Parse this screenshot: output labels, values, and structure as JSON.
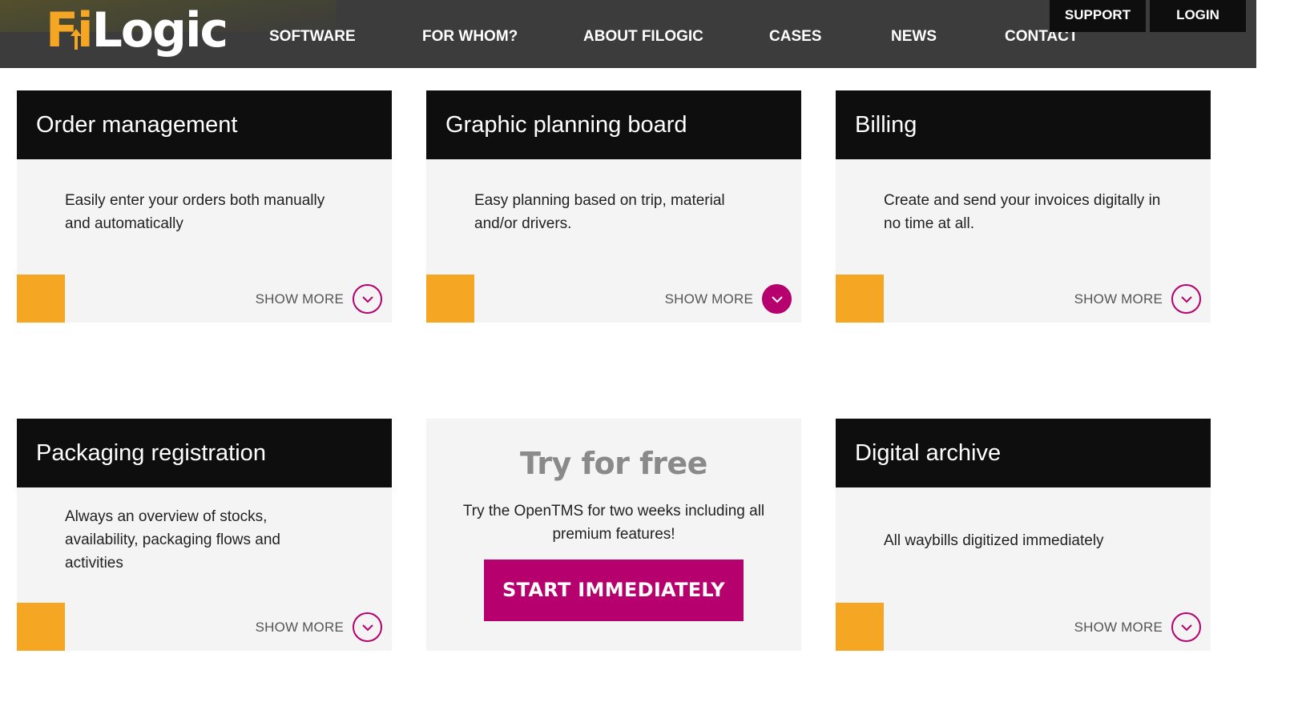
{
  "brand": {
    "logo_fi": "Fi",
    "logo_rest": "Logic",
    "accent": "#f5a623",
    "magenta": "#b5006e"
  },
  "nav": [
    "SOFTWARE",
    "FOR WHOM?",
    "ABOUT FILOGIC",
    "CASES",
    "NEWS",
    "CONTACT"
  ],
  "top_buttons": {
    "support": "SUPPORT",
    "login": "LOGIN"
  },
  "cards": [
    {
      "title": "Order management",
      "desc": "Easily enter your orders both manually and automatically",
      "show_more": "SHOW MORE",
      "icon": "chevron-down-icon",
      "active": false
    },
    {
      "title": "Graphic planning board",
      "desc": "Easy planning based on trip, material and/or drivers.",
      "show_more": "SHOW MORE",
      "icon": "chevron-down-icon",
      "active": true
    },
    {
      "title": "Billing",
      "desc": "Create and send your invoices digitally in no time at all.",
      "show_more": "SHOW MORE",
      "icon": "chevron-down-icon",
      "active": false
    },
    {
      "title": "Packaging registration",
      "desc": "Always an overview of stocks, availability, packaging flows and activities",
      "show_more": "SHOW MORE",
      "icon": "chevron-down-icon",
      "active": false
    },
    {
      "title": "Digital archive",
      "desc": "All waybills digitized immediately",
      "show_more": "SHOW MORE",
      "icon": "chevron-down-icon",
      "active": false
    }
  ],
  "try": {
    "title": "Try for free",
    "desc": "Try the OpenTMS for two weeks including all premium features!",
    "button": "START IMMEDIATELY"
  }
}
